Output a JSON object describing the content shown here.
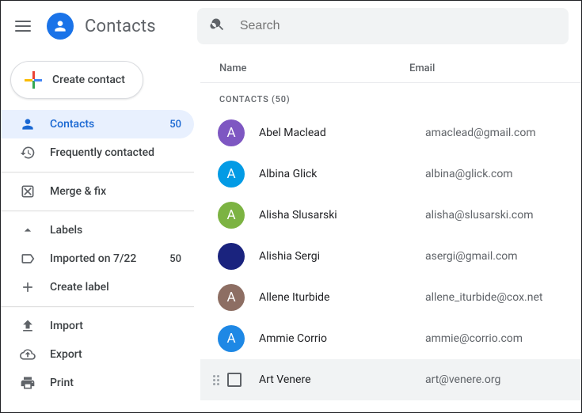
{
  "app": {
    "title": "Contacts"
  },
  "search": {
    "placeholder": "Search"
  },
  "create": {
    "label": "Create contact"
  },
  "sidebar": {
    "contacts": {
      "label": "Contacts",
      "count": "50"
    },
    "frequent": {
      "label": "Frequently contacted"
    },
    "merge": {
      "label": "Merge & fix"
    },
    "labels_header": "Labels",
    "label_items": [
      {
        "label": "Imported on 7/22",
        "count": "50"
      }
    ],
    "create_label": "Create label",
    "import": "Import",
    "export": "Export",
    "print": "Print"
  },
  "list": {
    "columns": {
      "name": "Name",
      "email": "Email"
    },
    "group_label": "CONTACTS (50)",
    "contacts": [
      {
        "initial": "A",
        "name": "Abel Maclead",
        "email": "amaclead@gmail.com",
        "avatar_color": "#7e57c2"
      },
      {
        "initial": "A",
        "name": "Albina Glick",
        "email": "albina@glick.com",
        "avatar_color": "#039be5"
      },
      {
        "initial": "A",
        "name": "Alisha Slusarski",
        "email": "alisha@slusarski.com",
        "avatar_color": "#7cb342"
      },
      {
        "initial": "",
        "name": "Alishia Sergi",
        "email": "asergi@gmail.com",
        "avatar_color": "#1a237e"
      },
      {
        "initial": "A",
        "name": "Allene Iturbide",
        "email": "allene_iturbide@cox.net",
        "avatar_color": "#8d6e63"
      },
      {
        "initial": "A",
        "name": "Ammie Corrio",
        "email": "ammie@corrio.com",
        "avatar_color": "#1e88e5"
      },
      {
        "initial": "",
        "name": "Art Venere",
        "email": "art@venere.org",
        "avatar_color": ""
      }
    ]
  }
}
